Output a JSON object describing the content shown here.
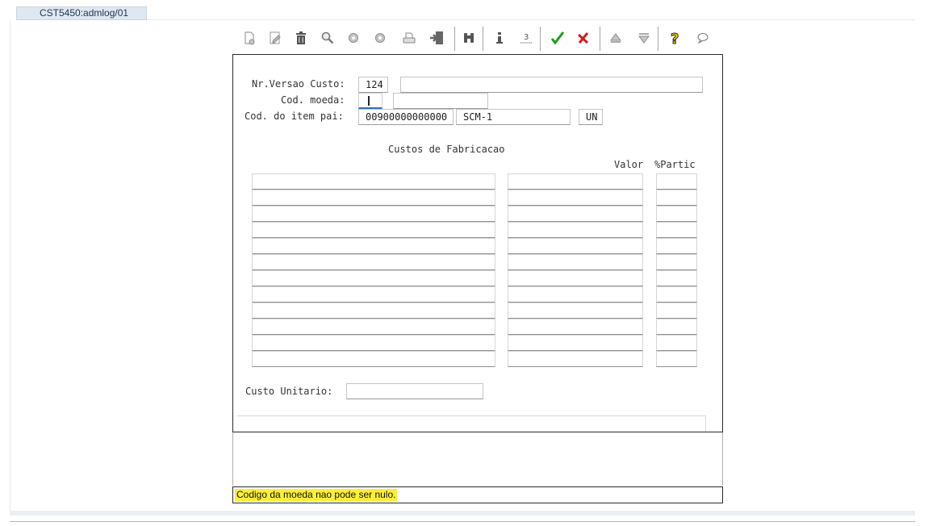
{
  "window": {
    "tab_title": "CST5450:admlog/01"
  },
  "toolbar": {
    "icons": [
      "new-document-icon",
      "edit-icon",
      "trash-icon",
      "search-icon",
      "previous-icon",
      "next-icon",
      "print-icon",
      "export-icon",
      "binoculars-icon",
      "info-icon",
      "list-icon",
      "confirm-check-icon",
      "cancel-x-icon",
      "up-arrow-icon",
      "down-arrow-icon",
      "help-icon",
      "comment-icon"
    ],
    "colors": {
      "confirm": "#1aa01a",
      "cancel": "#d81c1c",
      "help": "#f2d200"
    }
  },
  "form": {
    "nr_versao_label": "Nr.Versao Custo:",
    "nr_versao_value": "124",
    "nr_versao_desc": "",
    "cod_moeda_label": "Cod. moeda:",
    "cod_moeda_value": "",
    "cod_moeda_desc": "",
    "cod_item_label": "Cod. do item pai:",
    "cod_item_value": "00900000000000",
    "cod_item_desc": "SCM-1",
    "unit_value": "UN",
    "section_title": "Custos de Fabricacao",
    "col_valor": "Valor",
    "col_partic": "%Partic",
    "custo_unitario_label": "Custo Unitario:",
    "custo_unitario_value": ""
  },
  "status": {
    "message": "Codigo da moeda nao pode ser nulo.",
    "highlight_color": "#ffee33"
  }
}
